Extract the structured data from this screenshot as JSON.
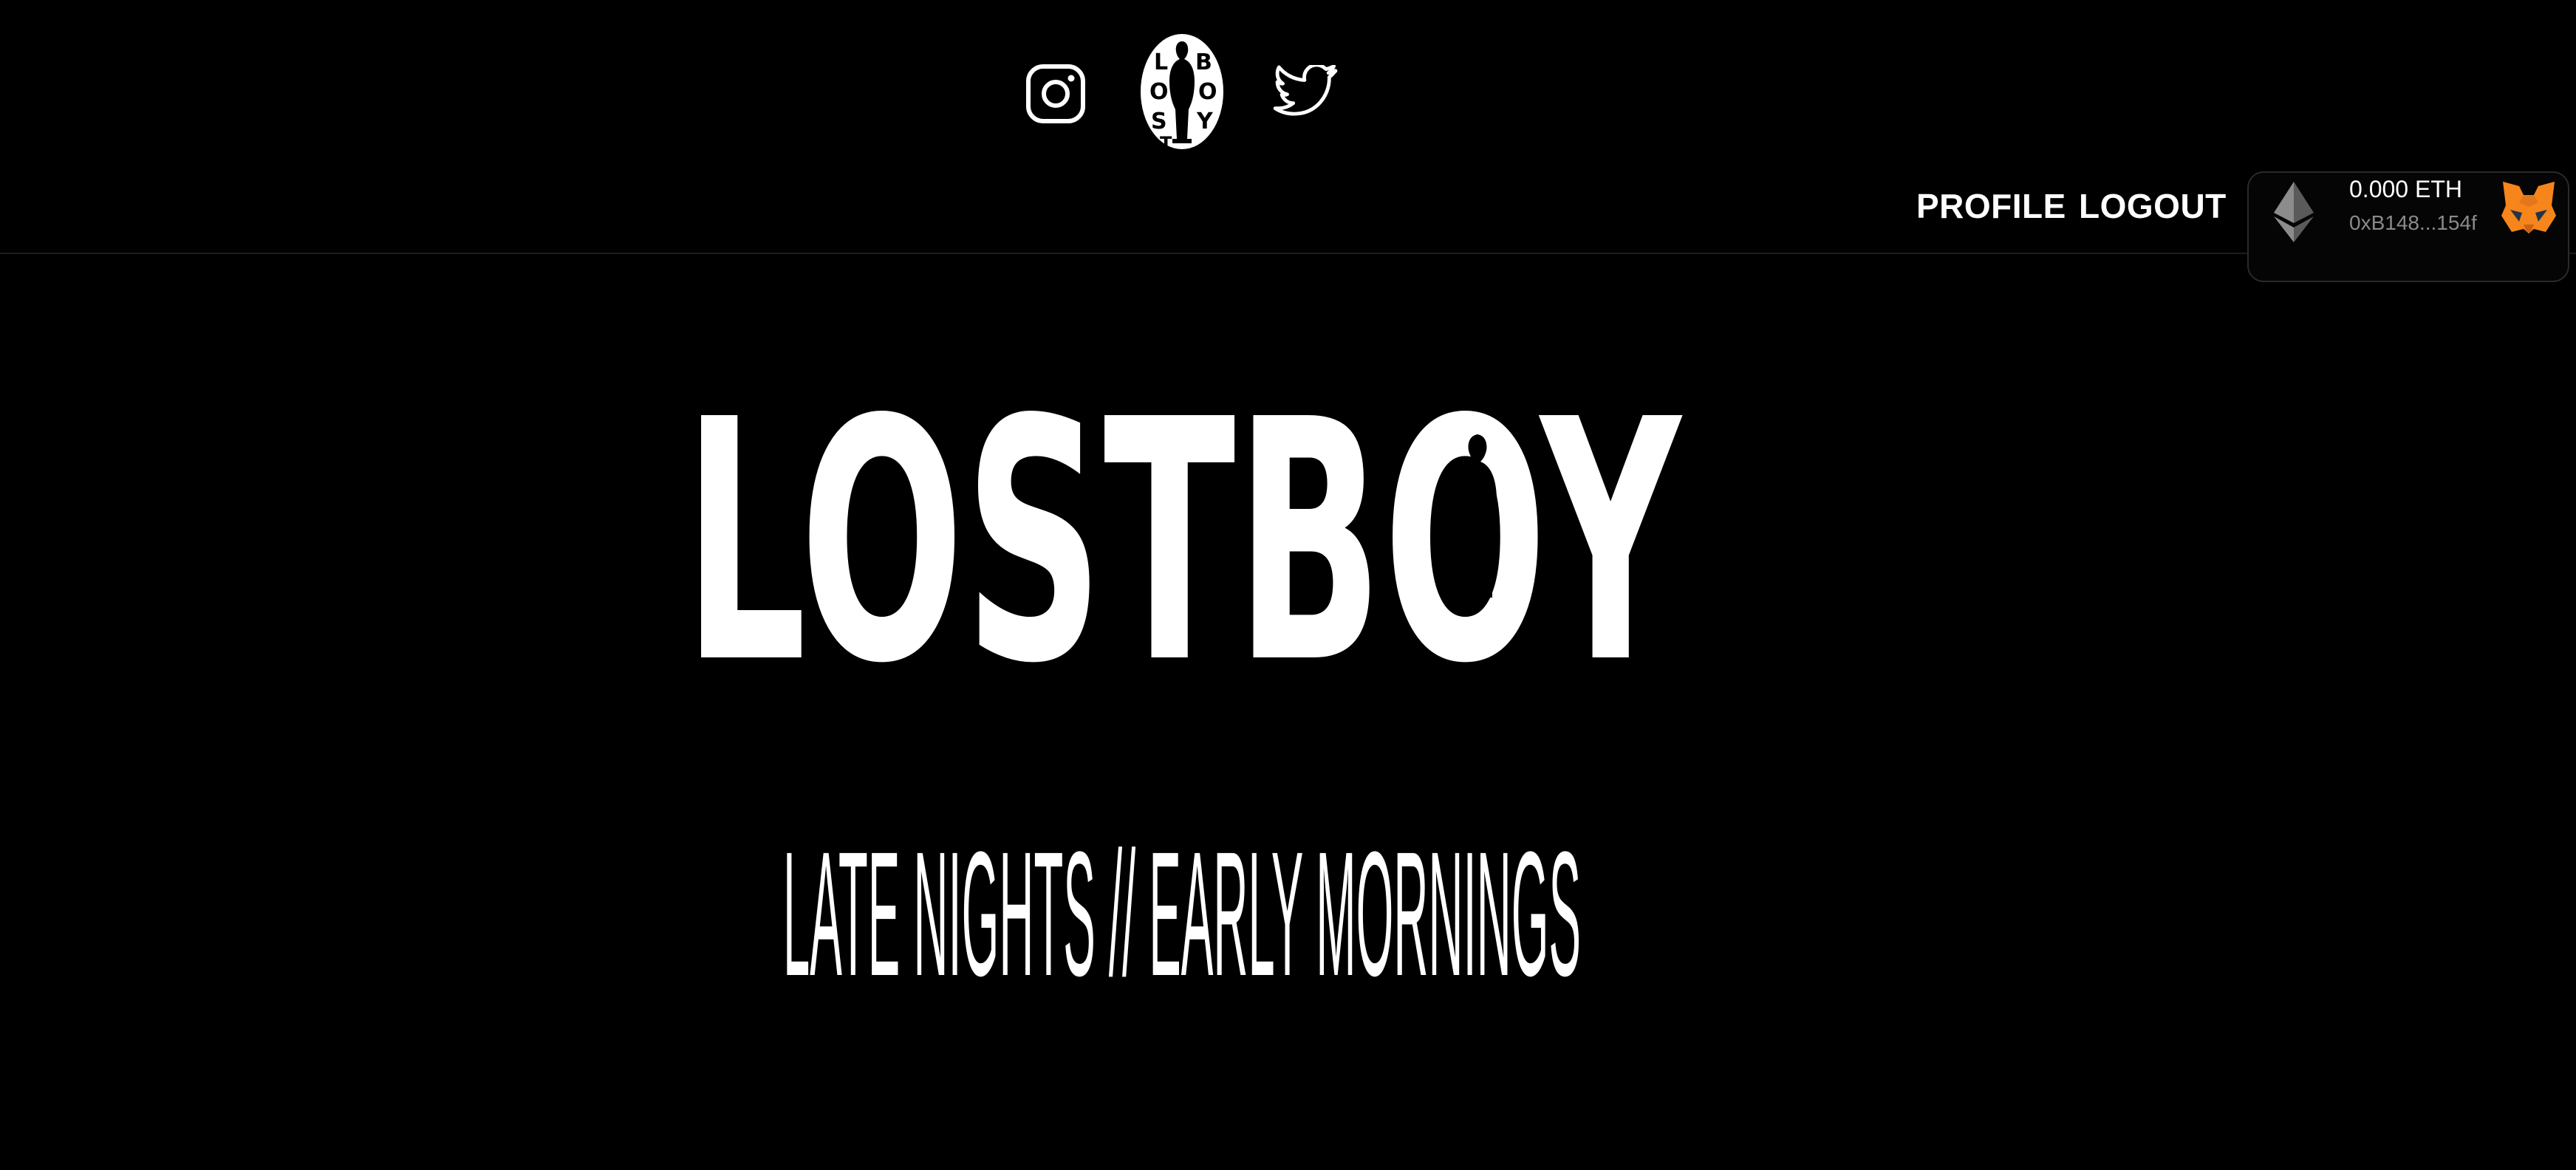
{
  "social": {
    "icons": [
      "instagram-icon",
      "lostboy-logo-icon",
      "twitter-icon"
    ],
    "logo_letters": "LOST BOY"
  },
  "nav": {
    "profile_label": "PROFILE",
    "logout_label": "LOGOUT"
  },
  "wallet": {
    "balance": "0.000 ETH",
    "address": "0xB148...154f",
    "currency_icon": "ethereum-icon",
    "provider_icon": "metamask-fox-icon"
  },
  "hero": {
    "title": "LOSTBOY",
    "tagline": "LATE NIGHTS // EARLY MORNINGS"
  },
  "colors": {
    "background": "#000000",
    "text": "#ffffff",
    "muted": "#8a8a8a",
    "fox_orange": "#e2761b"
  }
}
